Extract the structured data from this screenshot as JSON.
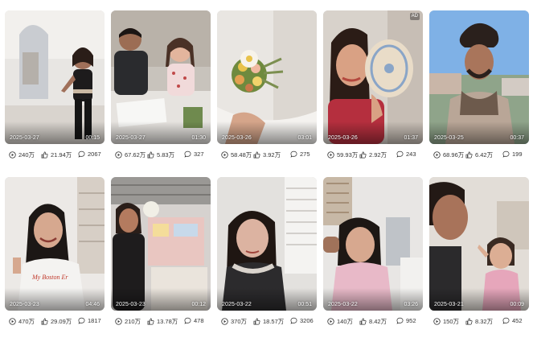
{
  "cards": [
    {
      "date": "2025-03-27",
      "duration": "00:15",
      "plays": "240万",
      "likes": "21.94万",
      "comments": "2067",
      "ad": ""
    },
    {
      "date": "2025-03-27",
      "duration": "01:30",
      "plays": "67.62万",
      "likes": "5.83万",
      "comments": "327",
      "ad": ""
    },
    {
      "date": "2025-03-26",
      "duration": "03:01",
      "plays": "58.48万",
      "likes": "3.92万",
      "comments": "275",
      "ad": ""
    },
    {
      "date": "2025-03-26",
      "duration": "01:37",
      "plays": "59.93万",
      "likes": "2.92万",
      "comments": "243",
      "ad": "AD"
    },
    {
      "date": "2025-03-25",
      "duration": "00:37",
      "plays": "68.96万",
      "likes": "6.42万",
      "comments": "199",
      "ad": ""
    },
    {
      "date": "2025-03-23",
      "duration": "04:46",
      "plays": "470万",
      "likes": "29.09万",
      "comments": "1817",
      "ad": ""
    },
    {
      "date": "2025-03-23",
      "duration": "00:12",
      "plays": "210万",
      "likes": "13.78万",
      "comments": "478",
      "ad": ""
    },
    {
      "date": "2025-03-22",
      "duration": "00:51",
      "plays": "370万",
      "likes": "18.57万",
      "comments": "3206",
      "ad": ""
    },
    {
      "date": "2025-03-22",
      "duration": "03:26",
      "plays": "140万",
      "likes": "8.42万",
      "comments": "952",
      "ad": ""
    },
    {
      "date": "2025-03-21",
      "duration": "00:09",
      "plays": "150万",
      "likes": "8.32万",
      "comments": "452",
      "ad": ""
    }
  ],
  "shirt_text": "My Boston Er",
  "icons": {
    "plays": "play-circle-icon",
    "likes": "thumbs-up-icon",
    "comments": "comment-bubble-icon"
  }
}
